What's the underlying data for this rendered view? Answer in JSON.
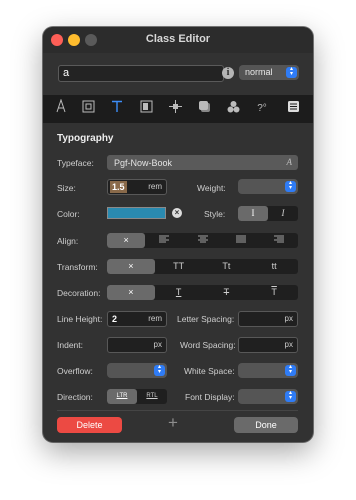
{
  "window": {
    "title": "Class Editor"
  },
  "header": {
    "class_name": "a",
    "state_select": "normal"
  },
  "toolbar": {
    "tools": [
      "typography-icon",
      "box-icon",
      "text-icon",
      "background-icon",
      "position-icon",
      "effects-icon",
      "filters-icon",
      "transform-icon",
      "grid-icon"
    ]
  },
  "typography": {
    "section_title": "Typography",
    "typeface_label": "Typeface:",
    "typeface_value": "Pgf-Now-Book",
    "size_label": "Size:",
    "size_value": "1.5",
    "size_unit": "rem",
    "weight_label": "Weight:",
    "color_label": "Color:",
    "color_value": "#2a8ab0",
    "style_label": "Style:",
    "style_options": [
      "I",
      "I"
    ],
    "align_label": "Align:",
    "transform_label": "Transform:",
    "transform_options": [
      "×",
      "TT",
      "Tt",
      "tt"
    ],
    "decoration_label": "Decoration:",
    "decoration_options": [
      "×",
      "T",
      "T",
      "T"
    ],
    "line_height_label": "Line Height:",
    "line_height_value": "2",
    "line_height_unit": "rem",
    "letter_spacing_label": "Letter Spacing:",
    "letter_spacing_unit": "px",
    "indent_label": "Indent:",
    "indent_unit": "px",
    "word_spacing_label": "Word Spacing:",
    "word_spacing_unit": "px",
    "overflow_label": "Overflow:",
    "white_space_label": "White Space:",
    "direction_label": "Direction:",
    "direction_options": [
      "LTR",
      "RTL"
    ],
    "font_display_label": "Font Display:"
  },
  "footer": {
    "delete_label": "Delete",
    "add_label": "+",
    "done_label": "Done"
  }
}
